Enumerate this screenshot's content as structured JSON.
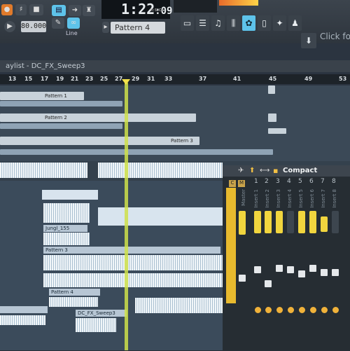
{
  "toolbar": {
    "tempo": "80.000",
    "clock": "1:22",
    "clock_frames": ":09",
    "clock_unit": "M:S:CS",
    "pattern": "Pattern 4",
    "line_mode": "Line",
    "click_hint": "Click fo"
  },
  "playlist": {
    "title": "aylist - DC_FX_Sweep3",
    "ruler": [
      "13",
      "15",
      "17",
      "19",
      "21",
      "23",
      "25",
      "27",
      "29",
      "31",
      "33",
      "37",
      "41",
      "45",
      "49",
      "53"
    ],
    "patterns": [
      "Pattern 1",
      "Pattern 2",
      "Pattern 3",
      "Pattern 3",
      "Pattern 4",
      "Jungl_155",
      "DC_FX_Sweep3"
    ]
  },
  "mixer": {
    "view": "Compact",
    "master_label": "Master",
    "cm": [
      "C",
      "M"
    ],
    "channels": [
      "1",
      "2",
      "3",
      "4",
      "5",
      "6",
      "7",
      "8"
    ],
    "channel_names": [
      "Insert 1",
      "Insert 2",
      "Insert 3",
      "Insert 4",
      "Insert 5",
      "Insert 6",
      "Insert 7",
      "Insert 8"
    ]
  },
  "colors": {
    "accent": "#5ec3ea",
    "playhead": "#cfe04a",
    "mixer_slot": "#f1d53e"
  },
  "icons": [
    "record-icon",
    "play-icon",
    "stop-icon",
    "pattern-song-icon",
    "tool-pencil-icon",
    "tool-brush-icon",
    "snap-icon",
    "magnet-icon",
    "mixer-icon",
    "browser-icon",
    "plugin-icon",
    "download-icon"
  ]
}
